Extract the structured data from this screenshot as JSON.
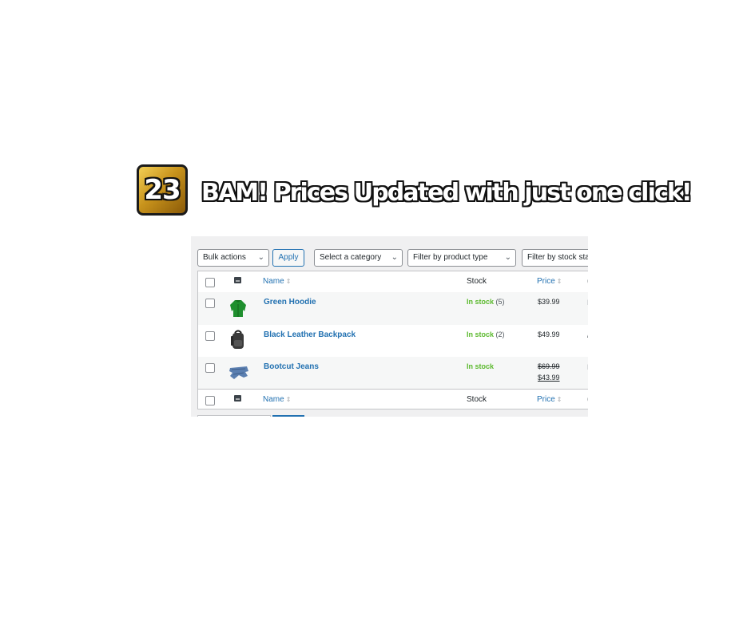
{
  "headline": {
    "badge_number": "23",
    "text": "BAM! Prices Updated with just one click!"
  },
  "toolbar": {
    "bulk_actions": "Bulk actions",
    "apply": "Apply",
    "category": "Select a category",
    "product_type": "Filter by product type",
    "stock_status": "Filter by stock sta"
  },
  "columns": {
    "name": "Name",
    "stock": "Stock",
    "price": "Price"
  },
  "rows": [
    {
      "name": "Green Hoodie",
      "stock": "In stock",
      "count": "(5)",
      "price": "$39.99"
    },
    {
      "name": "Black Leather Backpack",
      "stock": "In stock",
      "count": "(2)",
      "price": "$49.99"
    },
    {
      "name": "Bootcut Jeans",
      "stock": "In stock",
      "old_price": "$69.99",
      "new_price": "$43.99"
    }
  ],
  "colors": {
    "link": "#2271b1",
    "in_stock": "#5bb92d",
    "badge_gold": "#c8931c"
  }
}
